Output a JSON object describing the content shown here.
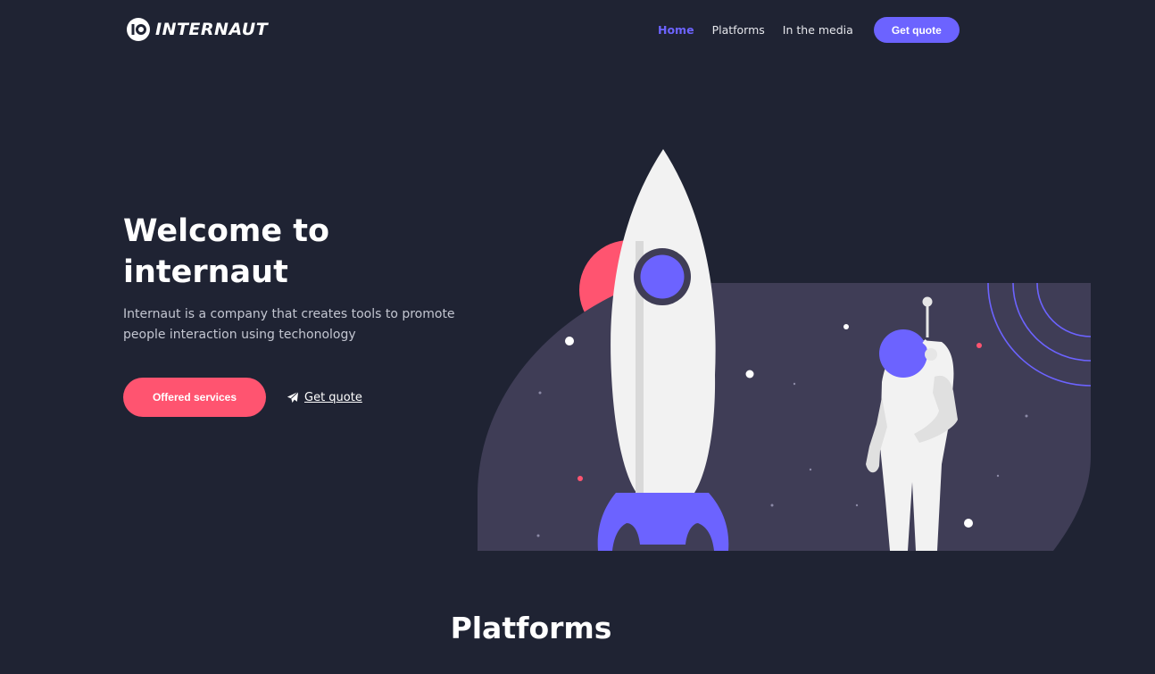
{
  "brand": {
    "name": "INTERNAUT"
  },
  "nav": {
    "links": [
      {
        "label": "Home",
        "active": true
      },
      {
        "label": "Platforms",
        "active": false
      },
      {
        "label": "In the media",
        "active": false
      }
    ],
    "cta_label": "Get quote"
  },
  "hero": {
    "title": "Welcome to internaut",
    "subtitle": "Internaut is a company that creates tools to promote people interaction using techonology",
    "primary_button": "Offered services",
    "secondary_link": "Get quote"
  },
  "sections": {
    "platforms_title": "Platforms"
  },
  "colors": {
    "background": "#1f2333",
    "accent": "#6c63ff",
    "pink": "#ff5470",
    "panel": "#3f3d56"
  },
  "icons": {
    "brand_mark": "io-logo-icon",
    "send": "paper-plane-icon"
  }
}
